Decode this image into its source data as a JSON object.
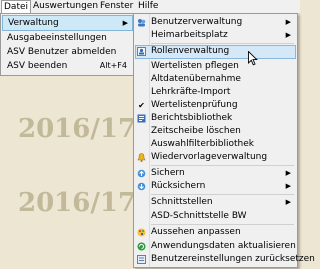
{
  "menubar": [
    "Datei",
    "Auswertungen",
    "Fenster",
    "Hilfe"
  ],
  "background_text": "2016/17",
  "datei_menu": [
    {
      "label": "Verwaltung",
      "submenu": true,
      "selected": true
    },
    {
      "label": "Ausgabeeinstellungen"
    },
    {
      "label": "ASV Benutzer abmelden"
    },
    {
      "label": "ASV beenden",
      "shortcut": "Alt+F4"
    }
  ],
  "verwaltung_menu": [
    {
      "label": "Benutzerverwaltung",
      "icon": "users-icon",
      "submenu": true
    },
    {
      "label": "Heimarbeitsplatz",
      "icon": "none",
      "submenu": true
    },
    {
      "label": "Rollenverwaltung",
      "icon": "roles-icon",
      "highlighted": true
    },
    {
      "label": "Wertelisten pflegen",
      "icon": "none"
    },
    {
      "label": "Altdatenübernahme",
      "icon": "none"
    },
    {
      "label": "Lehrkräfte-Import",
      "icon": "none"
    },
    {
      "label": "Wertelistenprüfung",
      "icon": "checkmark-icon"
    },
    {
      "label": "Berichtsbibliothek",
      "icon": "book-icon"
    },
    {
      "label": "Zeitscheibe löschen",
      "icon": "none"
    },
    {
      "label": "Auswahlfilterbibliothek",
      "icon": "none"
    },
    {
      "label": "Wiedervorlageverwaltung",
      "icon": "bell-icon"
    },
    {
      "label": "Sichern",
      "icon": "backup-icon",
      "submenu": true
    },
    {
      "label": "Rücksichern",
      "icon": "restore-icon",
      "submenu": true
    },
    {
      "label": "Schnittstellen",
      "icon": "none",
      "submenu": true
    },
    {
      "label": "ASD-Schnittstelle BW",
      "icon": "none"
    },
    {
      "label": "Aussehen anpassen",
      "icon": "palette-icon"
    },
    {
      "label": "Anwendungsdaten aktualisieren",
      "icon": "refresh-icon"
    },
    {
      "label": "Benutzereinstellungen zurücksetzen",
      "icon": "reset-icon"
    }
  ]
}
